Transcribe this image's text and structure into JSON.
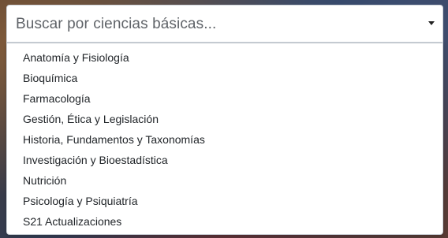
{
  "select": {
    "placeholder": "Buscar por ciencias básicas...",
    "caret_icon": "caret-down-icon"
  },
  "options": [
    "Anatomía y Fisiología",
    "Bioquímica",
    "Farmacología",
    "Gestión, Ética y Legislación",
    "Historia, Fundamentos y Taxonomías",
    "Investigación y Bioestadística",
    "Nutrición",
    "Psicología y Psiquiatría",
    "S21 Actualizaciones"
  ]
}
